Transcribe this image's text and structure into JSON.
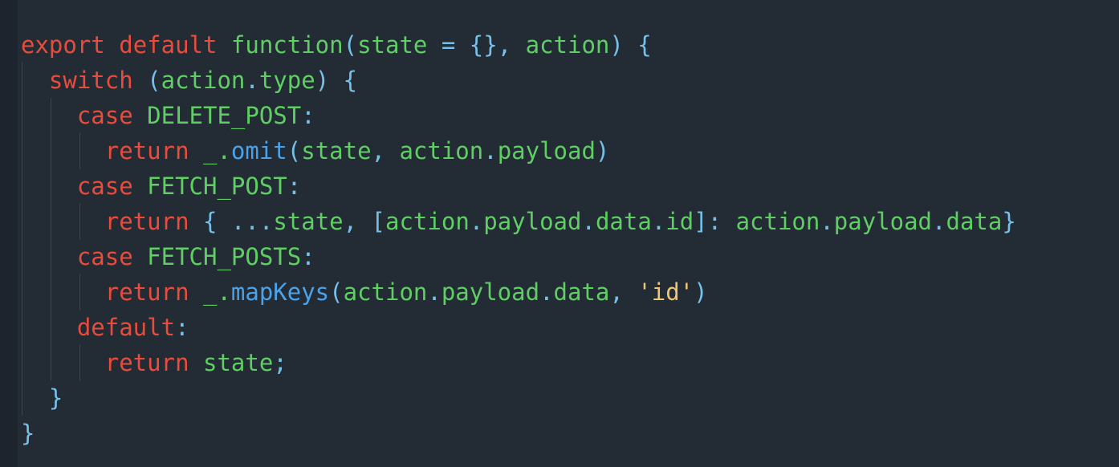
{
  "editor": {
    "colors": {
      "background": "#232b35",
      "gutter": "#1d242d",
      "keyword": "#e84c3d",
      "identifier": "#5fcf64",
      "punctuation": "#77c0e8",
      "method": "#4aa3ea",
      "string": "#f0c674"
    },
    "lines": [
      {
        "indent": 0,
        "tokens": [
          {
            "t": "export",
            "c": "kw"
          },
          {
            "t": " ",
            "c": "pl"
          },
          {
            "t": "default",
            "c": "kw"
          },
          {
            "t": " ",
            "c": "pl"
          },
          {
            "t": "function",
            "c": "fn"
          },
          {
            "t": "(",
            "c": "pn"
          },
          {
            "t": "state",
            "c": "fn"
          },
          {
            "t": " = ",
            "c": "pn"
          },
          {
            "t": "{}",
            "c": "pn"
          },
          {
            "t": ", ",
            "c": "pn"
          },
          {
            "t": "action",
            "c": "fn"
          },
          {
            "t": ") {",
            "c": "pn"
          }
        ]
      },
      {
        "indent": 1,
        "tokens": [
          {
            "t": "switch",
            "c": "kw"
          },
          {
            "t": " (",
            "c": "pn"
          },
          {
            "t": "action",
            "c": "fn"
          },
          {
            "t": ".",
            "c": "pn"
          },
          {
            "t": "type",
            "c": "fn"
          },
          {
            "t": ") {",
            "c": "pn"
          }
        ]
      },
      {
        "indent": 2,
        "tokens": [
          {
            "t": "case",
            "c": "kw"
          },
          {
            "t": " ",
            "c": "pl"
          },
          {
            "t": "DELETE_POST",
            "c": "fn"
          },
          {
            "t": ":",
            "c": "pn"
          }
        ]
      },
      {
        "indent": 3,
        "tokens": [
          {
            "t": "return",
            "c": "kw"
          },
          {
            "t": " _.",
            "c": "fn"
          },
          {
            "t": "omit",
            "c": "mt"
          },
          {
            "t": "(",
            "c": "pn"
          },
          {
            "t": "state",
            "c": "fn"
          },
          {
            "t": ", ",
            "c": "pn"
          },
          {
            "t": "action",
            "c": "fn"
          },
          {
            "t": ".",
            "c": "pn"
          },
          {
            "t": "payload",
            "c": "fn"
          },
          {
            "t": ")",
            "c": "pn"
          }
        ]
      },
      {
        "indent": 2,
        "tokens": [
          {
            "t": "case",
            "c": "kw"
          },
          {
            "t": " ",
            "c": "pl"
          },
          {
            "t": "FETCH_POST",
            "c": "fn"
          },
          {
            "t": ":",
            "c": "pn"
          }
        ]
      },
      {
        "indent": 3,
        "tokens": [
          {
            "t": "return",
            "c": "kw"
          },
          {
            "t": " { ",
            "c": "pn"
          },
          {
            "t": "...",
            "c": "pn"
          },
          {
            "t": "state",
            "c": "fn"
          },
          {
            "t": ", [",
            "c": "pn"
          },
          {
            "t": "action",
            "c": "fn"
          },
          {
            "t": ".",
            "c": "pn"
          },
          {
            "t": "payload",
            "c": "fn"
          },
          {
            "t": ".",
            "c": "pn"
          },
          {
            "t": "data",
            "c": "fn"
          },
          {
            "t": ".",
            "c": "pn"
          },
          {
            "t": "id",
            "c": "fn"
          },
          {
            "t": "]: ",
            "c": "pn"
          },
          {
            "t": "action",
            "c": "fn"
          },
          {
            "t": ".",
            "c": "pn"
          },
          {
            "t": "payload",
            "c": "fn"
          },
          {
            "t": ".",
            "c": "pn"
          },
          {
            "t": "data",
            "c": "fn"
          },
          {
            "t": "}",
            "c": "pn"
          }
        ]
      },
      {
        "indent": 2,
        "tokens": [
          {
            "t": "case",
            "c": "kw"
          },
          {
            "t": " ",
            "c": "pl"
          },
          {
            "t": "FETCH_POSTS",
            "c": "fn"
          },
          {
            "t": ":",
            "c": "pn"
          }
        ]
      },
      {
        "indent": 3,
        "tokens": [
          {
            "t": "return",
            "c": "kw"
          },
          {
            "t": " _.",
            "c": "fn"
          },
          {
            "t": "mapKeys",
            "c": "mt"
          },
          {
            "t": "(",
            "c": "pn"
          },
          {
            "t": "action",
            "c": "fn"
          },
          {
            "t": ".",
            "c": "pn"
          },
          {
            "t": "payload",
            "c": "fn"
          },
          {
            "t": ".",
            "c": "pn"
          },
          {
            "t": "data",
            "c": "fn"
          },
          {
            "t": ", ",
            "c": "pn"
          },
          {
            "t": "'id'",
            "c": "st"
          },
          {
            "t": ")",
            "c": "pn"
          }
        ]
      },
      {
        "indent": 2,
        "tokens": [
          {
            "t": "default",
            "c": "kw"
          },
          {
            "t": ":",
            "c": "pn"
          }
        ]
      },
      {
        "indent": 3,
        "tokens": [
          {
            "t": "return",
            "c": "kw"
          },
          {
            "t": " ",
            "c": "pl"
          },
          {
            "t": "state",
            "c": "fn"
          },
          {
            "t": ";",
            "c": "pn"
          }
        ]
      },
      {
        "indent": 1,
        "tokens": [
          {
            "t": "}",
            "c": "pn"
          }
        ]
      },
      {
        "indent": 0,
        "tokens": [
          {
            "t": "}",
            "c": "pn"
          }
        ]
      }
    ]
  }
}
